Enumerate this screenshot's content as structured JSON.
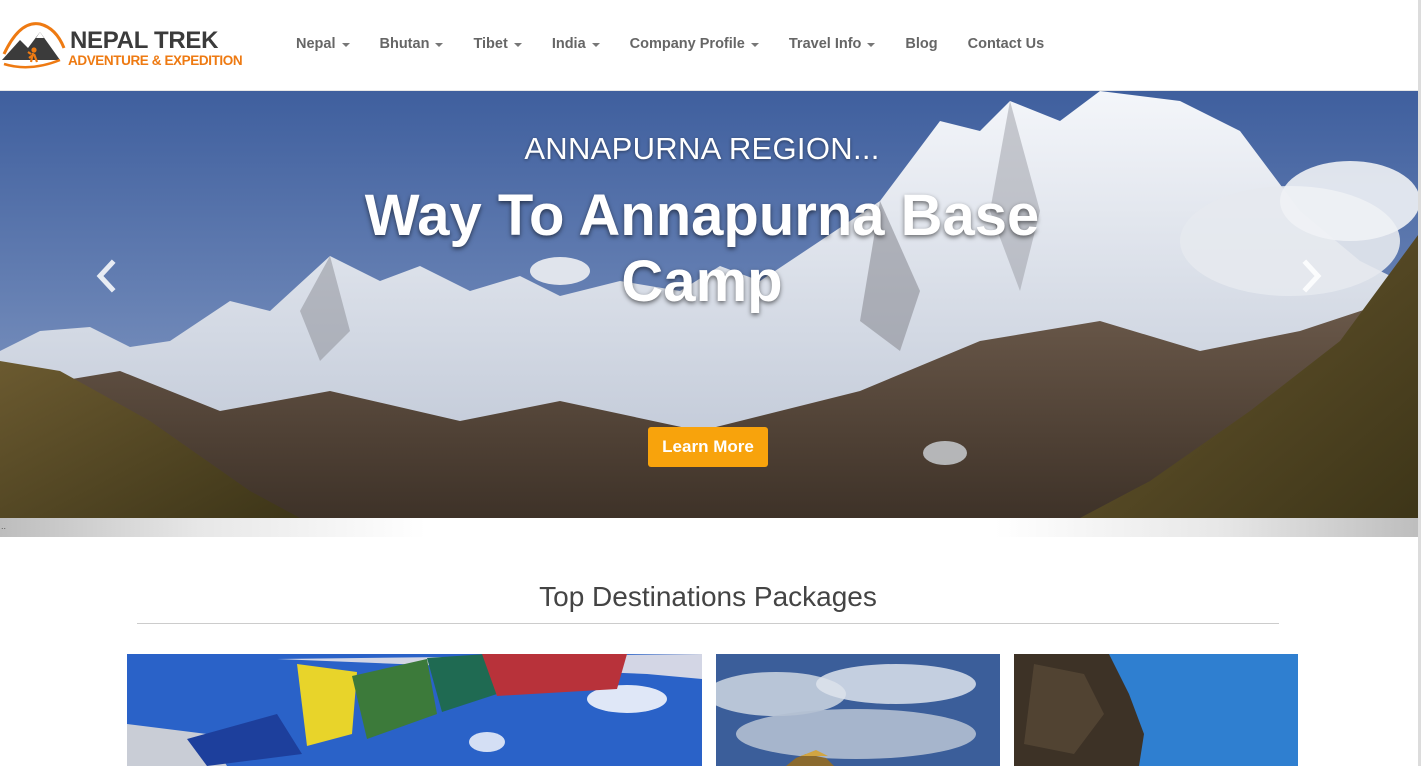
{
  "brand": {
    "name": "NEPAL TREK",
    "tagline": "ADVENTURE & EXPEDITION",
    "colors": {
      "dark": "#3b3b3b",
      "accent": "#ee7a12"
    }
  },
  "nav": {
    "items": [
      {
        "label": "Nepal",
        "dropdown": true
      },
      {
        "label": "Bhutan",
        "dropdown": true
      },
      {
        "label": "Tibet",
        "dropdown": true
      },
      {
        "label": "India",
        "dropdown": true
      },
      {
        "label": "Company Profile",
        "dropdown": true
      },
      {
        "label": "Travel Info",
        "dropdown": true
      },
      {
        "label": "Blog",
        "dropdown": false
      },
      {
        "label": "Contact Us",
        "dropdown": false
      }
    ]
  },
  "hero": {
    "region": "ANNAPURNA REGION...",
    "title": "Way To Annapurna Base Camp",
    "button_label": "Learn More",
    "button_color": "#f8a30c",
    "prev_icon": "chevron-left-icon",
    "next_icon": "chevron-right-icon"
  },
  "misc": {
    "dots": ".."
  },
  "section": {
    "title": "Top Destinations Packages"
  },
  "cards": [
    {
      "image": "prayer-flags-photo"
    },
    {
      "image": "monastery-clouds-photo"
    },
    {
      "image": "cliff-monastery-photo"
    }
  ]
}
